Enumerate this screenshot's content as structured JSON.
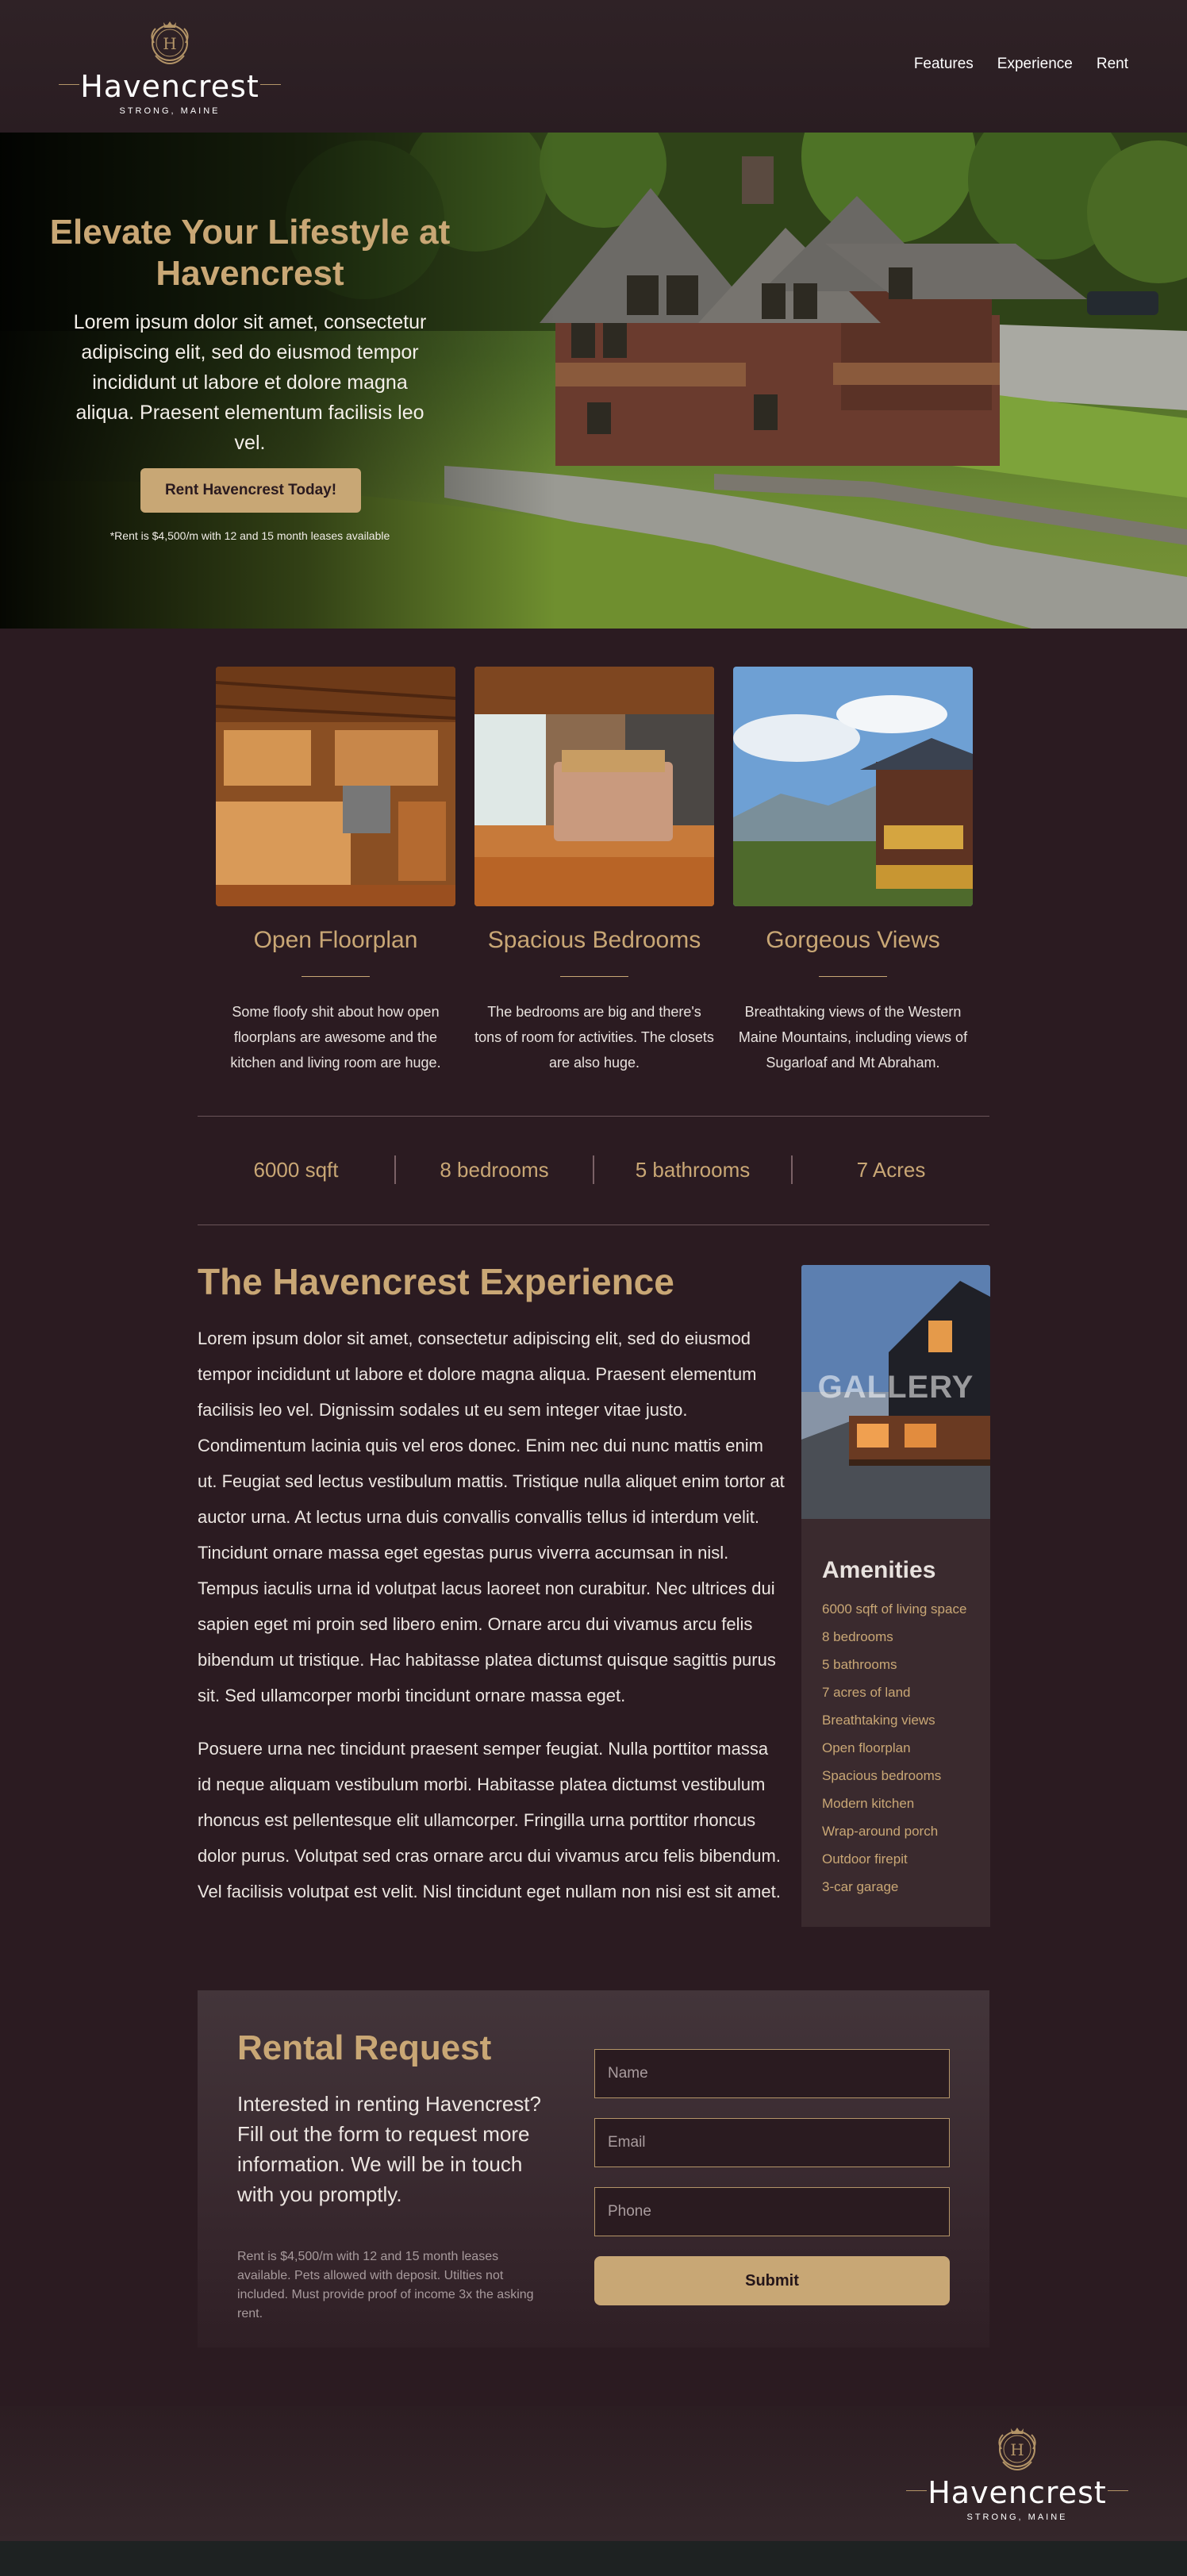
{
  "brand": {
    "name": "Havencrest",
    "tagline": "STRONG, MAINE",
    "crest_letter": "H"
  },
  "nav": {
    "items": [
      "Features",
      "Experience",
      "Rent"
    ]
  },
  "hero": {
    "title": "Elevate Your Lifestyle at Havencrest",
    "lead": "Lorem ipsum dolor sit amet, consectetur adipiscing elit, sed do eiusmod tempor incididunt ut labore et dolore magna aliqua. Praesent elementum facilisis leo vel.",
    "cta_label": "Rent Havencrest Today!",
    "note": "*Rent is $4,500/m with 12 and 15 month leases available"
  },
  "features": [
    {
      "title": "Open Floorplan",
      "text": "Some floofy shit about how open floorplans are awesome and the kitchen and living room are huge."
    },
    {
      "title": "Spacious Bedrooms",
      "text": "The bedrooms are big and there's tons of room for activities. The closets are also huge."
    },
    {
      "title": "Gorgeous Views",
      "text": "Breathtaking views of the Western Maine Mountains, including views of Sugarloaf and Mt Abraham."
    }
  ],
  "stats": [
    "6000 sqft",
    "8 bedrooms",
    "5 bathrooms",
    "7 Acres"
  ],
  "experience": {
    "title": "The Havencrest Experience",
    "paragraphs": [
      "Lorem ipsum dolor sit amet, consectetur adipiscing elit, sed do eiusmod tempor incididunt ut labore et dolore magna aliqua. Praesent elementum facilisis leo vel. Dignissim sodales ut eu sem integer vitae justo. Condimentum lacinia quis vel eros donec. Enim nec dui nunc mattis enim ut. Feugiat sed lectus vestibulum mattis. Tristique nulla aliquet enim tortor at auctor urna. At lectus urna duis convallis convallis tellus id interdum velit. Tincidunt ornare massa eget egestas purus viverra accumsan in nisl. Tempus iaculis urna id volutpat lacus laoreet non curabitur. Nec ultrices dui sapien eget mi proin sed libero enim. Ornare arcu dui vivamus arcu felis bibendum ut tristique. Hac habitasse platea dictumst quisque sagittis purus sit. Sed ullamcorper morbi tincidunt ornare massa eget.",
      "Posuere urna nec tincidunt praesent semper feugiat. Nulla porttitor massa id neque aliquam vestibulum morbi. Habitasse platea dictumst vestibulum rhoncus est pellentesque elit ullamcorper. Fringilla urna porttitor rhoncus dolor purus. Volutpat sed cras ornare arcu dui vivamus arcu felis bibendum. Vel facilisis volutpat est velit. Nisl tincidunt eget nullam non nisi est sit amet."
    ],
    "gallery_label": "GALLERY"
  },
  "amenities": {
    "title": "Amenities",
    "items": [
      "6000 sqft of living space",
      "8 bedrooms",
      "5 bathrooms",
      "7 acres of land",
      "Breathtaking views",
      "Open floorplan",
      "Spacious bedrooms",
      "Modern kitchen",
      "Wrap-around porch",
      "Outdoor firepit",
      "3-car garage"
    ]
  },
  "rental": {
    "title": "Rental Request",
    "intro": "Interested in renting Havencrest? Fill out the form to request more information. We will be in touch with you promptly.",
    "fine_print": "Rent is $4,500/m with 12 and 15 month leases available. Pets allowed with deposit. Utilties not included. Must provide proof of income 3x the asking rent.",
    "name_placeholder": "Name",
    "email_placeholder": "Email",
    "phone_placeholder": "Phone",
    "submit_label": "Submit"
  },
  "colors": {
    "background": "#2b1b21",
    "accent_gold": "#c9a775",
    "panel": "#3a2a2e"
  }
}
